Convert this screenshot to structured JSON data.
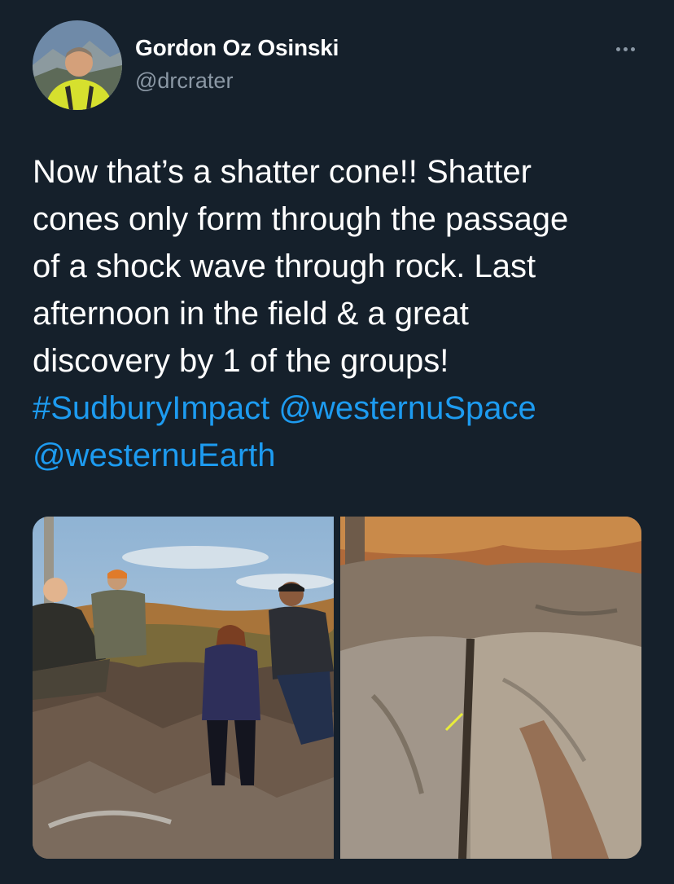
{
  "author": {
    "display_name": "Gordon Oz Osinski",
    "handle": "@drcrater",
    "avatar_icon": "profile-photo"
  },
  "tweet": {
    "lines": [
      "Now that’s a shatter cone!! Shatter",
      "cones only form through the passage",
      "of a shock wave through rock. Last",
      "afternoon in the field & a great",
      "discovery by 1 of the groups!"
    ],
    "hashtag": "#SudburyImpact",
    "mention1": "@westernuSpace",
    "mention2": "@westernuEarth"
  },
  "more_icon": "ellipsis-icon",
  "colors": {
    "background": "#15202b",
    "text": "#ffffff",
    "secondary": "#8b98a5",
    "link": "#1d9bf0"
  },
  "media": [
    {
      "icon": "group-photo"
    },
    {
      "icon": "rock-closeup-photo"
    }
  ]
}
